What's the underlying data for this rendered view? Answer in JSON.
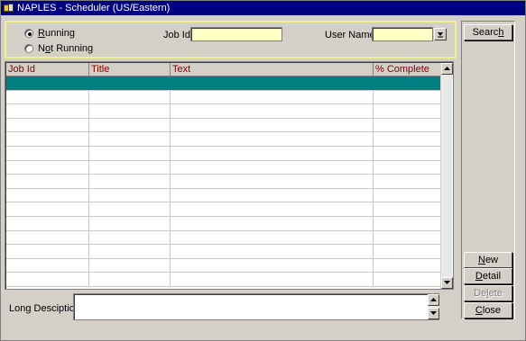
{
  "window": {
    "title": "NAPLES - Scheduler (US/Eastern)"
  },
  "filters": {
    "running_label": "Running",
    "running_mnemonic": "R",
    "running_rest": "unning",
    "not_running_label": "Not Running",
    "not_running_pre": "N",
    "not_running_mnemonic": "o",
    "not_running_rest": "t Running",
    "selected": "running",
    "job_id_label": "Job Id",
    "job_id_value": "",
    "user_name_label": "User Name",
    "user_name_value": ""
  },
  "grid": {
    "columns": [
      "Job Id",
      "Title",
      "Text",
      "% Complete"
    ],
    "rows": [
      [
        "",
        "",
        "",
        ""
      ],
      [
        "",
        "",
        "",
        ""
      ],
      [
        "",
        "",
        "",
        ""
      ],
      [
        "",
        "",
        "",
        ""
      ],
      [
        "",
        "",
        "",
        ""
      ],
      [
        "",
        "",
        "",
        ""
      ],
      [
        "",
        "",
        "",
        ""
      ],
      [
        "",
        "",
        "",
        ""
      ],
      [
        "",
        "",
        "",
        ""
      ],
      [
        "",
        "",
        "",
        ""
      ],
      [
        "",
        "",
        "",
        ""
      ],
      [
        "",
        "",
        "",
        ""
      ],
      [
        "",
        "",
        "",
        ""
      ],
      [
        "",
        "",
        "",
        ""
      ],
      [
        "",
        "",
        "",
        ""
      ]
    ],
    "selected_row": 0,
    "selected_color": "#008080",
    "header_text_color": "#800000"
  },
  "buttons": {
    "search": {
      "pre": "Searc",
      "mn": "h",
      "post": ""
    },
    "new": {
      "pre": "",
      "mn": "N",
      "post": "ew"
    },
    "detail": {
      "pre": "",
      "mn": "D",
      "post": "etail"
    },
    "delete": {
      "pre": "De",
      "mn": "l",
      "post": "ete"
    },
    "close": {
      "pre": "",
      "mn": "C",
      "post": "lose"
    }
  },
  "long_description": {
    "label": "Long Desciption",
    "value": ""
  },
  "colors": {
    "title_bar": "#000080",
    "field_bg": "#ffffc8",
    "panel_highlight": "#f0f088"
  }
}
